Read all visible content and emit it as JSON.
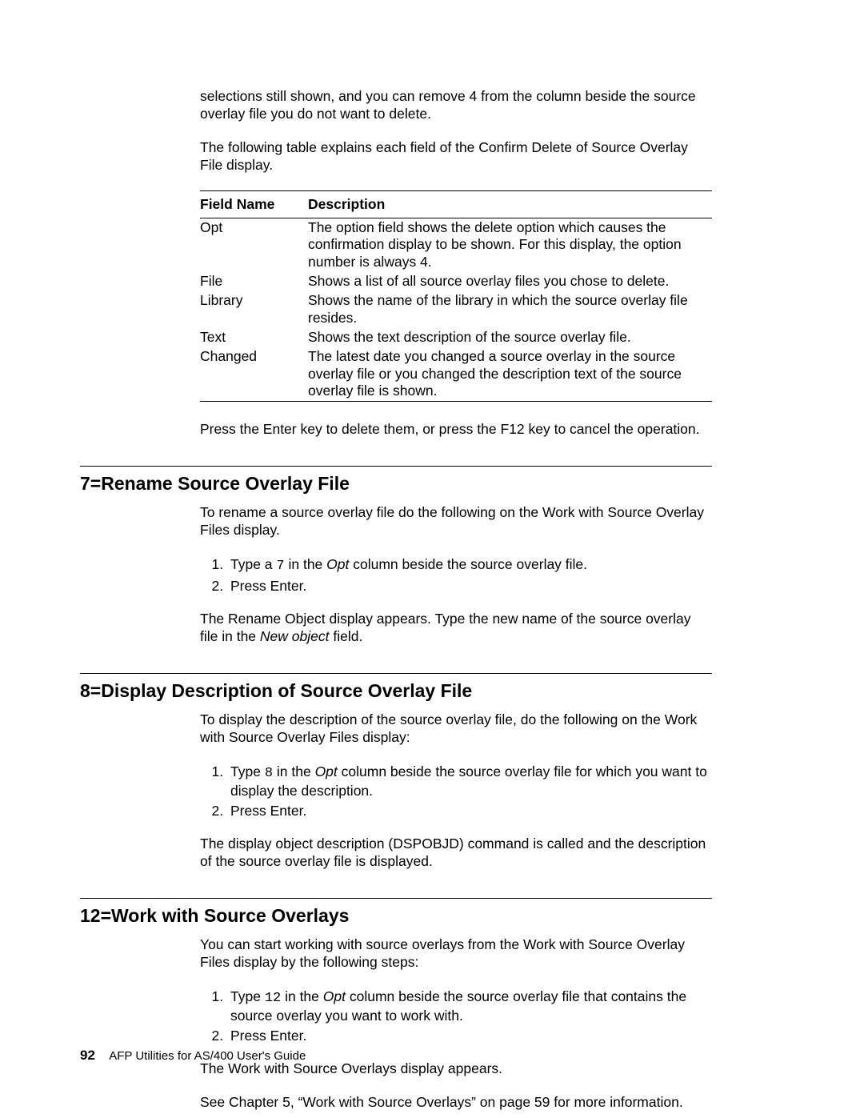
{
  "intro": {
    "p1": "selections still shown, and you can remove 4 from the column beside the source overlay file you do not want to delete.",
    "p2": "The following table explains each field of the Confirm Delete of Source Overlay File display."
  },
  "table": {
    "headers": {
      "field": "Field Name",
      "desc": "Description"
    },
    "rows": [
      {
        "field": "Opt",
        "desc": "The option field shows the delete option which causes the confirmation display to be shown.  For this display, the option number is always 4."
      },
      {
        "field": "File",
        "desc": "Shows a list of all source overlay files you chose to delete."
      },
      {
        "field": "Library",
        "desc": "Shows the name of the library in which the source overlay file resides."
      },
      {
        "field": "Text",
        "desc": "Shows the text description of the source overlay file."
      },
      {
        "field": "Changed",
        "desc": "The latest date you changed a source overlay in the source overlay file or you changed the description text of the source overlay file is shown."
      }
    ]
  },
  "after_table": "Press the Enter key to delete them, or press the F12 key to cancel the operation.",
  "sec7": {
    "heading": "7=Rename Source Overlay File",
    "p1": "To rename a source overlay file do the following on the Work with Source Overlay Files display.",
    "step1_a": "Type a ",
    "step1_code": "7",
    "step1_b": " in the ",
    "step1_ital": "Opt",
    "step1_c": " column beside the source overlay file.",
    "step2": "Press Enter.",
    "p2_a": "The Rename Object display appears.  Type the new name of the source overlay file in the ",
    "p2_ital": "New object",
    "p2_b": " field."
  },
  "sec8": {
    "heading": "8=Display Description of Source Overlay File",
    "p1": "To display the description of the source overlay file, do the following on the Work with Source Overlay Files display:",
    "step1_a": "Type ",
    "step1_code": "8",
    "step1_b": " in the ",
    "step1_ital": "Opt",
    "step1_c": " column beside the source overlay file for which you want to display the description.",
    "step2": "Press Enter.",
    "p2": "The display object description (DSPOBJD) command is called and the description of the source overlay file is displayed."
  },
  "sec12": {
    "heading": "12=Work with Source Overlays",
    "p1": "You can start working with source overlays from the Work with Source Overlay Files display by the following steps:",
    "step1_a": "Type ",
    "step1_code": "12",
    "step1_b": " in the ",
    "step1_ital": "Opt",
    "step1_c": " column beside the source overlay file that contains the source overlay you want to work with.",
    "step2": "Press Enter.",
    "p2": "The Work with Source Overlays display appears.",
    "p3": "See Chapter  5, “Work with Source Overlays” on page  59 for more information."
  },
  "footer": {
    "pagenum": "92",
    "title": "AFP Utilities for AS/400 User's Guide"
  }
}
